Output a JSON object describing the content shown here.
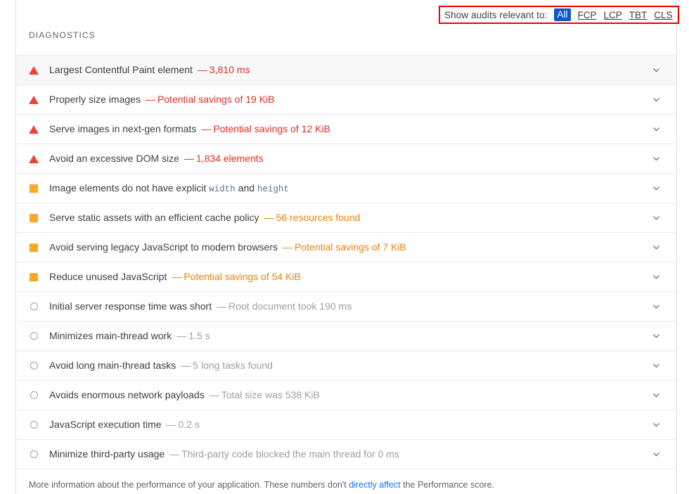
{
  "filter_bar": {
    "label": "Show audits relevant to:",
    "options": [
      {
        "label": "All",
        "selected": true
      },
      {
        "label": "FCP",
        "selected": false
      },
      {
        "label": "LCP",
        "selected": false
      },
      {
        "label": "TBT",
        "selected": false
      },
      {
        "label": "CLS",
        "selected": false
      }
    ],
    "highlight_color": "#ee0000",
    "selected_color": "#0b57d0"
  },
  "section": {
    "title": "DIAGNOSTICS"
  },
  "colors": {
    "fail": "#f04236",
    "fail_text": "#d93025",
    "average": "#fba72c",
    "average_text": "#e8820c",
    "pass": "#9aa0a6",
    "link": "#1a73e8",
    "code": "#5a6e9e"
  },
  "audits": [
    {
      "severity": "fail",
      "icon": "triangle-warning-icon",
      "title": "Largest Contentful Paint element",
      "separator": "—",
      "value": "3,810 ms",
      "hovered": true,
      "chevron": "chevron-down-icon"
    },
    {
      "severity": "fail",
      "icon": "triangle-warning-icon",
      "title": "Properly size images",
      "separator": "—",
      "value": "Potential savings of 19 KiB",
      "hovered": false,
      "chevron": "chevron-down-icon"
    },
    {
      "severity": "fail",
      "icon": "triangle-warning-icon",
      "title": "Serve images in next-gen formats",
      "separator": "—",
      "value": "Potential savings of 12 KiB",
      "hovered": false,
      "chevron": "chevron-down-icon"
    },
    {
      "severity": "fail",
      "icon": "triangle-warning-icon",
      "title": "Avoid an excessive DOM size",
      "separator": "—",
      "value": "1,834 elements",
      "hovered": false,
      "chevron": "chevron-down-icon"
    },
    {
      "severity": "average",
      "icon": "square-warning-icon",
      "title_parts": [
        {
          "type": "text",
          "text": "Image elements do not have explicit "
        },
        {
          "type": "code",
          "text": "width"
        },
        {
          "type": "text",
          "text": " and "
        },
        {
          "type": "code",
          "text": "height"
        }
      ],
      "title": "Image elements do not have explicit width and height",
      "separator": "",
      "value": "",
      "hovered": false,
      "chevron": "chevron-down-icon"
    },
    {
      "severity": "average",
      "icon": "square-warning-icon",
      "title": "Serve static assets with an efficient cache policy",
      "separator": "—",
      "value": "56 resources found",
      "hovered": false,
      "chevron": "chevron-down-icon"
    },
    {
      "severity": "average",
      "icon": "square-warning-icon",
      "title": "Avoid serving legacy JavaScript to modern browsers",
      "separator": "—",
      "value": "Potential savings of 7 KiB",
      "hovered": false,
      "chevron": "chevron-down-icon"
    },
    {
      "severity": "average",
      "icon": "square-warning-icon",
      "title": "Reduce unused JavaScript",
      "separator": "—",
      "value": "Potential savings of 54 KiB",
      "hovered": false,
      "chevron": "chevron-down-icon"
    },
    {
      "severity": "pass",
      "icon": "circle-pass-icon",
      "title": "Initial server response time was short",
      "separator": "—",
      "value": "Root document took 190 ms",
      "hovered": false,
      "chevron": "chevron-down-icon"
    },
    {
      "severity": "pass",
      "icon": "circle-pass-icon",
      "title": "Minimizes main-thread work",
      "separator": "—",
      "value": "1.5 s",
      "hovered": false,
      "chevron": "chevron-down-icon"
    },
    {
      "severity": "pass",
      "icon": "circle-pass-icon",
      "title": "Avoid long main-thread tasks",
      "separator": "—",
      "value": "5 long tasks found",
      "hovered": false,
      "chevron": "chevron-down-icon"
    },
    {
      "severity": "pass",
      "icon": "circle-pass-icon",
      "title": "Avoids enormous network payloads",
      "separator": "—",
      "value": "Total size was 538 KiB",
      "hovered": false,
      "chevron": "chevron-down-icon"
    },
    {
      "severity": "pass",
      "icon": "circle-pass-icon",
      "title": "JavaScript execution time",
      "separator": "—",
      "value": "0.2 s",
      "hovered": false,
      "chevron": "chevron-down-icon"
    },
    {
      "severity": "pass",
      "icon": "circle-pass-icon",
      "title": "Minimize third-party usage",
      "separator": "—",
      "value": "Third-party code blocked the main thread for 0 ms",
      "hovered": false,
      "chevron": "chevron-down-icon"
    }
  ],
  "footnote": {
    "before": "More information about the performance of your application. These numbers don't ",
    "link": "directly affect",
    "after": " the Performance score."
  }
}
